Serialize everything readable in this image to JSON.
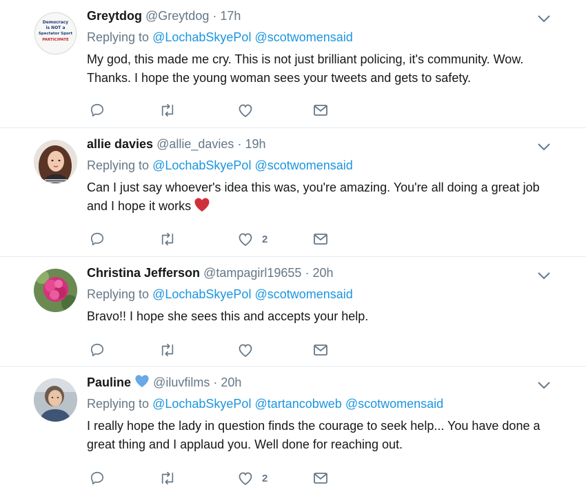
{
  "colors": {
    "text": "#14171a",
    "muted": "#657786",
    "link": "#1b95e0",
    "divider": "#e6ecf0",
    "heart": "#d0303c",
    "verified_heart": "#6aa8e6"
  },
  "tweets": [
    {
      "name": "Greytdog",
      "handle": "@Greytdog",
      "separator": "·",
      "time": "17h",
      "replying_label": "Replying to",
      "mentions": [
        "@LochabSkyePol",
        "@scotwomensaid"
      ],
      "text": "My god, this made me cry. This is not just brilliant policing, it's community. Wow. Thanks. I hope the young woman sees your tweets and gets to safety.",
      "avatar_badge": {
        "line1": "Democracy",
        "line2": "is NOT a",
        "line3": "Spectator Sport",
        "line4": "PARTICIPATE"
      },
      "like_count": ""
    },
    {
      "name": "allie davies",
      "handle": "@allie_davies",
      "separator": "·",
      "time": "19h",
      "replying_label": "Replying to",
      "mentions": [
        "@LochabSkyePol",
        "@scotwomensaid"
      ],
      "text": "Can I just say whoever's idea this was, you're amazing. You're all doing a great job and I hope it works",
      "emoji": "red-heart",
      "like_count": "2"
    },
    {
      "name": "Christina Jefferson",
      "handle": "@tampagirl19655",
      "separator": "·",
      "time": "20h",
      "replying_label": "Replying to",
      "mentions": [
        "@LochabSkyePol",
        "@scotwomensaid"
      ],
      "text": "Bravo!! I hope she sees this and accepts your help.",
      "like_count": ""
    },
    {
      "name": "Pauline",
      "name_emoji": "blue-heart",
      "handle": "@iluvfilms",
      "separator": "·",
      "time": "20h",
      "replying_label": "Replying to",
      "mentions": [
        "@LochabSkyePol",
        "@tartancobweb",
        "@scotwomensaid"
      ],
      "text": "I really hope the lady in question finds the courage to seek help... You have done a great thing and I applaud you. Well done for reaching out.",
      "like_count": "2"
    }
  ]
}
